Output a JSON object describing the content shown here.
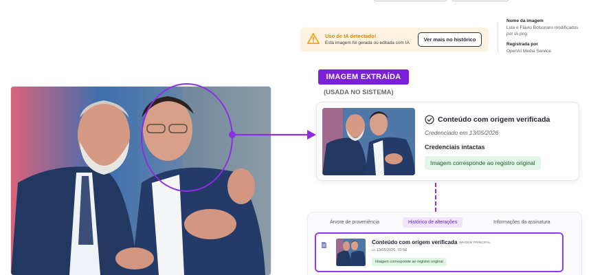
{
  "warning": {
    "title": "Uso de IA detectado!",
    "text": "Esta imagem foi gerada ou editada com IA",
    "button": "Ver mais no histórico",
    "icon": "warning-triangle-icon",
    "color": "#f1a21a"
  },
  "meta": {
    "name_label": "Nome da imagem",
    "name_value_line1": "Lula e Flávio Bolsonaro modificados",
    "name_value_line2": "por IA.png",
    "registered_label": "Registrada por",
    "registered_value": "OpenAI Media Service"
  },
  "extracted": {
    "badge": "IMAGEM EXTRAÍDA",
    "subtitle": "(USADA NO SISTEMA)",
    "accent": "#7b1fd8"
  },
  "verification_card": {
    "title": "Conteúdo com origem verificada",
    "date": "Credenciado em 13/05/2026",
    "credentials": "Credenciais intactas",
    "match": "Imagem corresponde ao registro original",
    "icon": "check-circle-icon"
  },
  "history_panel": {
    "tabs": [
      {
        "label": "Árvore de proveniência",
        "active": false
      },
      {
        "label": "Histórico de alterações",
        "active": true
      },
      {
        "label": "Informações da assinatura",
        "active": false
      }
    ],
    "entry": {
      "title": "Conteúdo com origem verificada",
      "tag": "IMAGEM PRINCIPAL",
      "date": "13/05/2026, 10:58",
      "match": "Imagem corresponde ao registro original"
    }
  }
}
